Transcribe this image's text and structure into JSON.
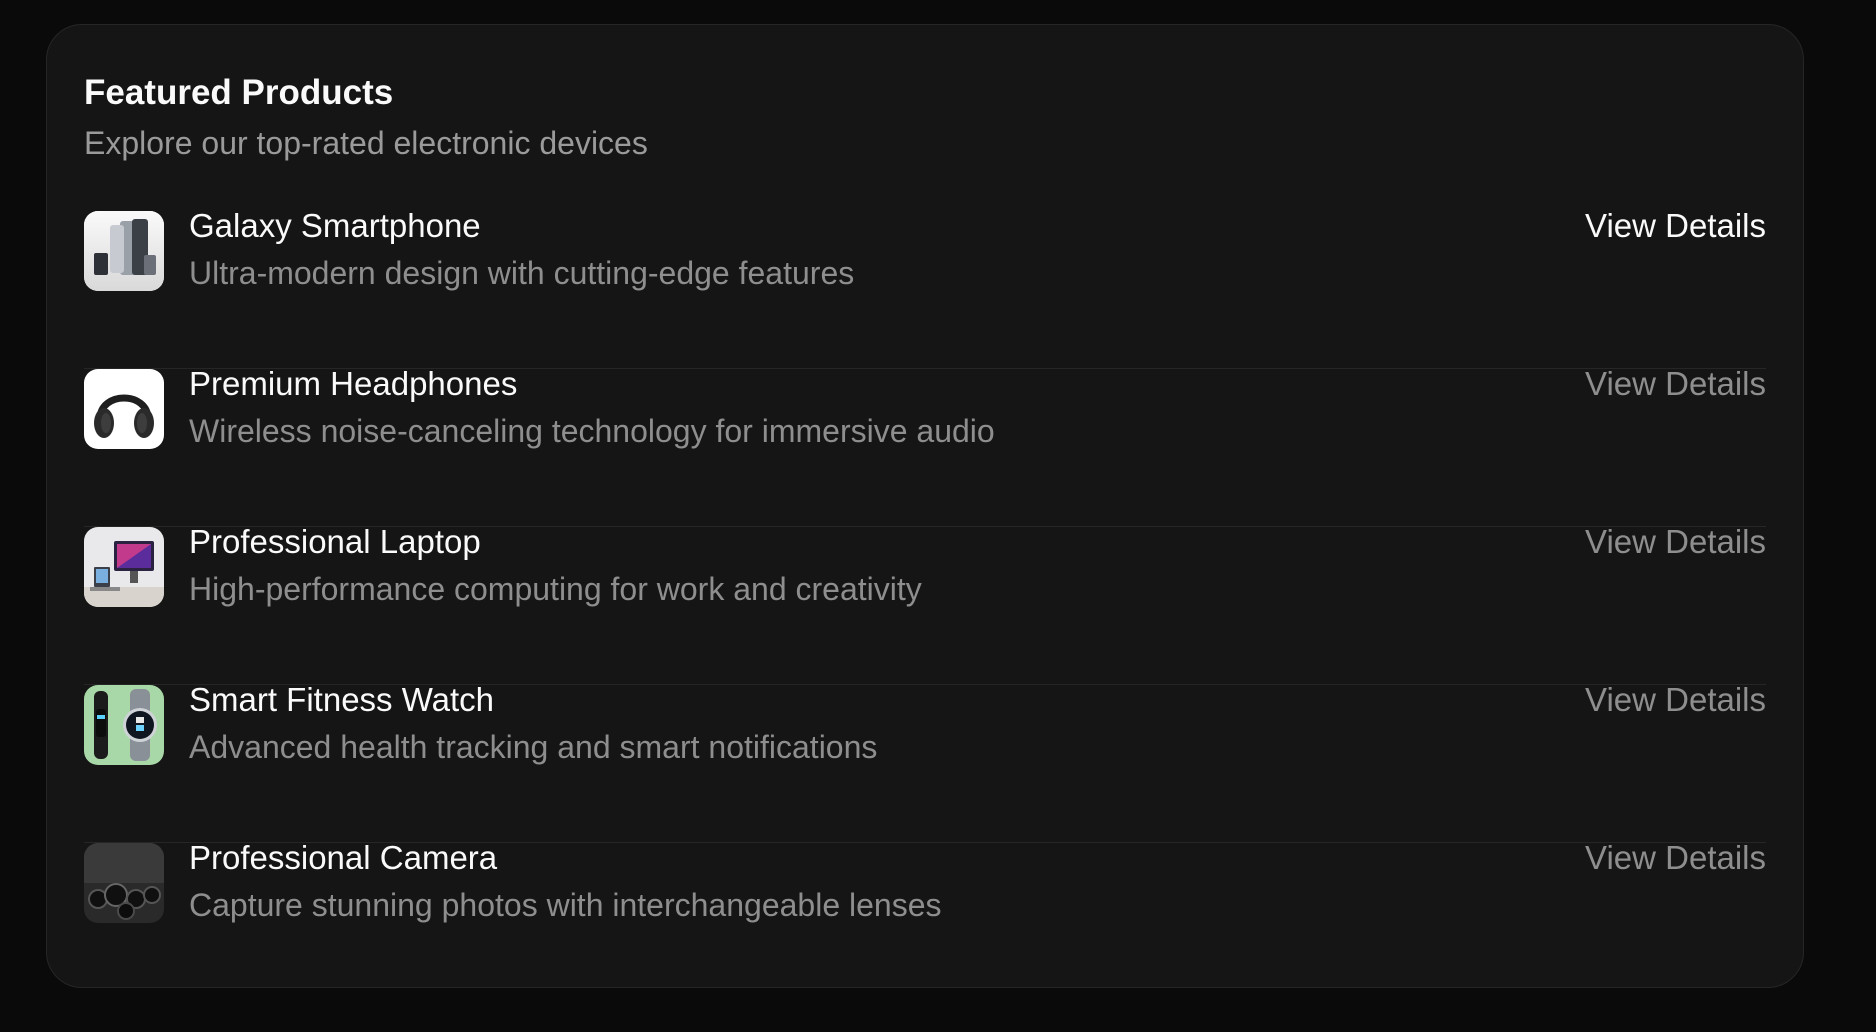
{
  "header": {
    "title": "Featured Products",
    "subtitle": "Explore our top-rated electronic devices"
  },
  "products": [
    {
      "name": "Galaxy Smartphone",
      "description": "Ultra-modern design with cutting-edge features",
      "action_label": "View Details",
      "icon": "smartphone-thumbnail"
    },
    {
      "name": "Premium Headphones",
      "description": "Wireless noise-canceling technology for immersive audio",
      "action_label": "View Details",
      "icon": "headphones-thumbnail"
    },
    {
      "name": "Professional Laptop",
      "description": "High-performance computing for work and creativity",
      "action_label": "View Details",
      "icon": "laptop-thumbnail"
    },
    {
      "name": "Smart Fitness Watch",
      "description": "Advanced health tracking and smart notifications",
      "action_label": "View Details",
      "icon": "watch-thumbnail"
    },
    {
      "name": "Professional Camera",
      "description": "Capture stunning photos with interchangeable lenses",
      "action_label": "View Details",
      "icon": "camera-thumbnail"
    }
  ],
  "colors": {
    "background": "#0a0a0a",
    "card": "#151515",
    "text_primary": "#fafafa",
    "text_muted": "#8e8e8e"
  }
}
